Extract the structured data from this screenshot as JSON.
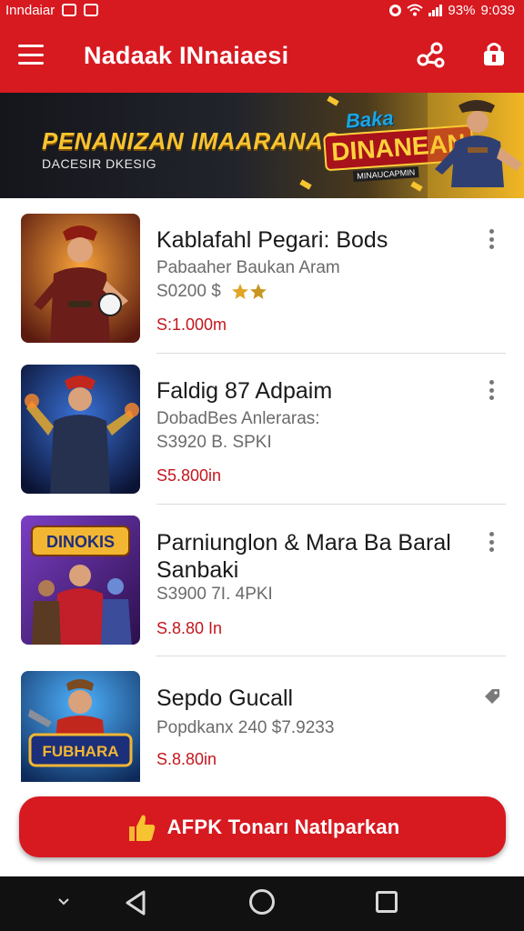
{
  "status_bar": {
    "carrier": "Inndaiar",
    "battery": "93%",
    "time": "9:039"
  },
  "app_bar": {
    "title": "Nadaak INnaiaesi",
    "icons": [
      "menu-icon",
      "share-icon",
      "lock-icon"
    ]
  },
  "banner": {
    "title": "PENANIZAN IMAARANAS",
    "subtitle": "DACESIR DKESIG",
    "badge_top": "Baka",
    "badge_main": "DINANEAN",
    "badge_sub": "MINAUCAPMIN"
  },
  "items": [
    {
      "title": "Kablafahl Pegari: Bods",
      "subtitle": "Pabaaher Baukan Aram",
      "meta": "S0200 $",
      "price": "S:1.000m",
      "action_icon": "more-vert-icon"
    },
    {
      "title": "Faldig 87 Adpaim",
      "subtitle": "DobadBes Anleraras:",
      "meta": "S3920 B. SPKI",
      "price": "S5.800in",
      "action_icon": "more-vert-icon"
    },
    {
      "title": "Parniunglon & Mara Ba Baral Sanbaki",
      "thumb_label": "DINOKIS",
      "meta": "S3900 7I. 4PKI",
      "price": "S.8.80 In",
      "action_icon": "more-vert-icon"
    },
    {
      "title": "Sepdo Gucall",
      "thumb_label": "FUBHARA",
      "meta": "Popdkanx 240 $7.9233",
      "price": "S.8.80in",
      "action_icon": "tag-icon"
    }
  ],
  "cta": {
    "label": "AFPK Tonarı Natlparkan"
  },
  "nav_bar": {
    "icons": [
      "chevron-down-icon",
      "back-icon",
      "home-icon",
      "recents-icon"
    ]
  },
  "colors": {
    "accent": "#d71920",
    "price": "#c4161d",
    "text": "#1a1a1a",
    "muted": "#6b6b6b"
  }
}
